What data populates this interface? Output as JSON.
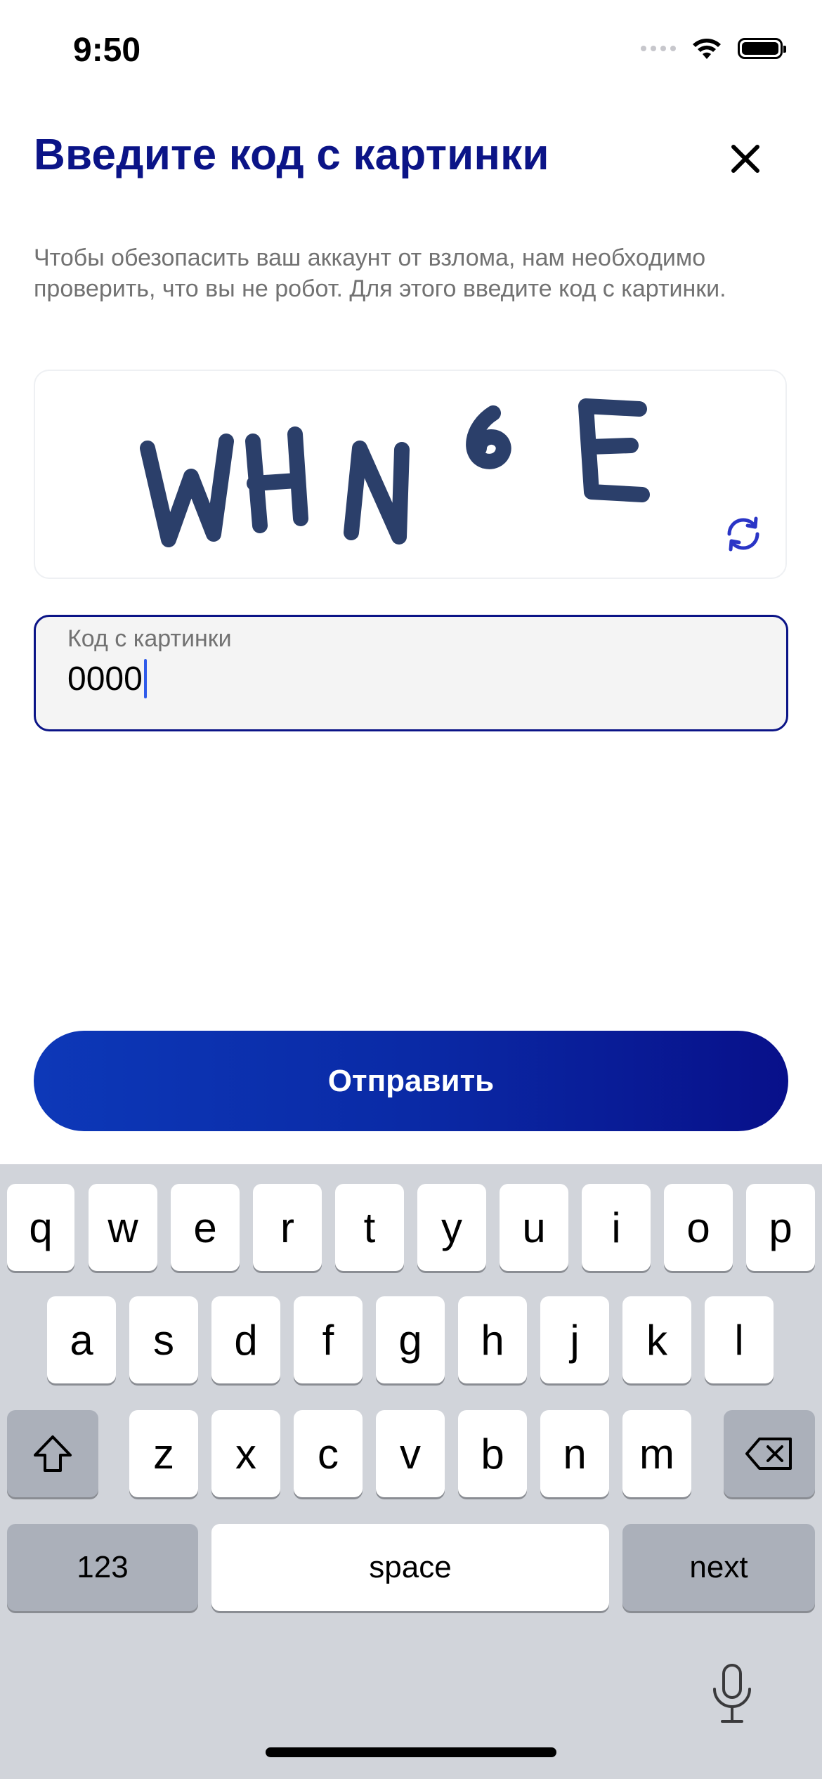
{
  "status_bar": {
    "time": "9:50"
  },
  "header": {
    "title": "Введите код с картинки",
    "description": "Чтобы обезопасить ваш аккаунт от взлома, нам необходимо проверить, что вы не робот. Для этого введите код с картинки."
  },
  "captcha": {
    "text": "WHN6E"
  },
  "code_field": {
    "label": "Код с картинки",
    "value": "0000"
  },
  "submit": {
    "label": "Отправить"
  },
  "keyboard": {
    "row1": [
      "q",
      "w",
      "e",
      "r",
      "t",
      "y",
      "u",
      "i",
      "o",
      "p"
    ],
    "row2": [
      "a",
      "s",
      "d",
      "f",
      "g",
      "h",
      "j",
      "k",
      "l"
    ],
    "row3": [
      "z",
      "x",
      "c",
      "v",
      "b",
      "n",
      "m"
    ],
    "numbers_key": "123",
    "space_key": "space",
    "return_key": "next"
  },
  "colors": {
    "accent": "#0b1487",
    "button_start": "#0d38b8",
    "button_end": "#08108a",
    "keyboard_bg": "#d1d4da"
  }
}
